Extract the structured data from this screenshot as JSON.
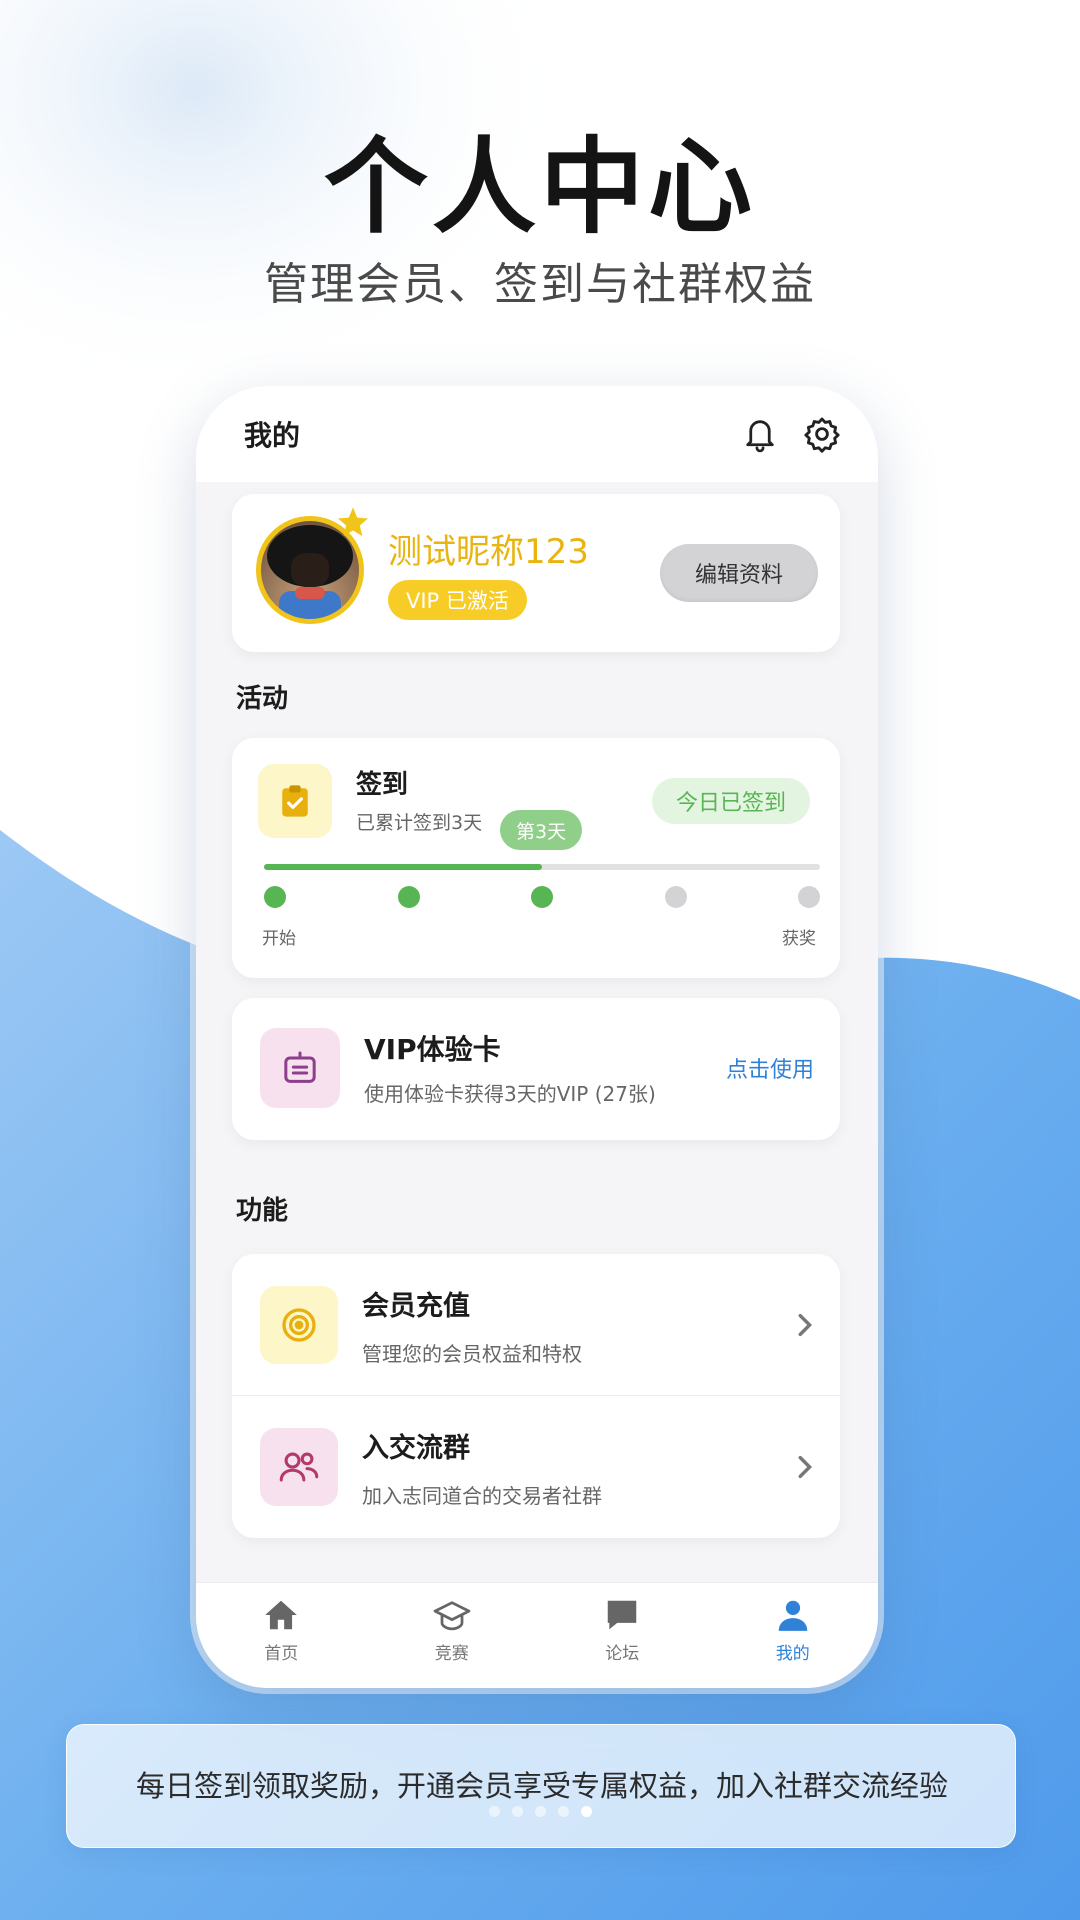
{
  "hero": {
    "title": "个人中心",
    "subtitle": "管理会员、签到与社群权益"
  },
  "app_header": {
    "title": "我的",
    "icons": [
      "bell-icon",
      "gear-icon"
    ]
  },
  "profile": {
    "nickname": "测试昵称123",
    "vip_status": "VIP 已激活",
    "edit_label": "编辑资料"
  },
  "activity": {
    "section_title": "活动",
    "checkin": {
      "title": "签到",
      "description": "已累计签到3天",
      "status": "今日已签到",
      "current_day_label": "第3天",
      "total_days": 5,
      "completed_days": 3,
      "start_label": "开始",
      "end_label": "获奖"
    },
    "vip_card": {
      "title": "VIP体验卡",
      "description": "使用体验卡获得3天的VIP (27张)",
      "action": "点击使用"
    }
  },
  "functions": {
    "section_title": "功能",
    "items": [
      {
        "title": "会员充值",
        "description": "管理您的会员权益和特权",
        "icon": "target-icon"
      },
      {
        "title": "入交流群",
        "description": "加入志同道合的交易者社群",
        "icon": "users-icon"
      }
    ]
  },
  "tabbar": {
    "items": [
      {
        "label": "首页",
        "icon": "home-icon",
        "active": false
      },
      {
        "label": "竞赛",
        "icon": "graduation-cap-icon",
        "active": false
      },
      {
        "label": "论坛",
        "icon": "chat-icon",
        "active": false
      },
      {
        "label": "我的",
        "icon": "person-icon",
        "active": true
      }
    ]
  },
  "caption": {
    "text": "每日签到领取奖励，开通会员享受专属权益，加入社群交流经验",
    "pages": 5,
    "active_page": 5
  },
  "colors": {
    "accent_blue": "#2f82d8",
    "vip_gold": "#f7cc26",
    "success_green": "#58b553"
  }
}
